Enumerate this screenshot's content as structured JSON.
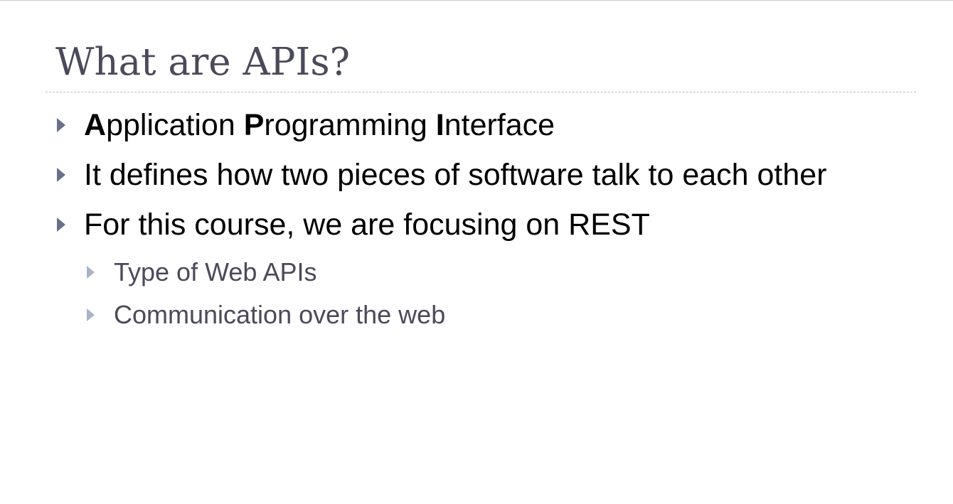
{
  "slide": {
    "title": "What are APIs?",
    "bullets": [
      {
        "level": 1,
        "segments": [
          {
            "text": "A",
            "bold": true
          },
          {
            "text": "pplication ",
            "bold": false
          },
          {
            "text": "P",
            "bold": true
          },
          {
            "text": "rogramming ",
            "bold": false
          },
          {
            "text": "I",
            "bold": true
          },
          {
            "text": "nterface",
            "bold": false
          }
        ]
      },
      {
        "level": 1,
        "text": "It defines how two pieces of software talk to each other"
      },
      {
        "level": 1,
        "text": "For this course, we are focusing on REST"
      },
      {
        "level": 2,
        "text": "Type of Web APIs"
      },
      {
        "level": 2,
        "text": "Communication over the web"
      }
    ]
  },
  "colors": {
    "title": "#4a4a5a",
    "level1_text": "#000000",
    "level1_marker": "#68708a",
    "level2_text": "#4a4a5a",
    "level2_marker": "#a9b5c4",
    "divider": "#b6bfca"
  },
  "icons": {
    "level1_marker": "triangle-right-icon",
    "level2_marker": "triangle-right-icon"
  }
}
